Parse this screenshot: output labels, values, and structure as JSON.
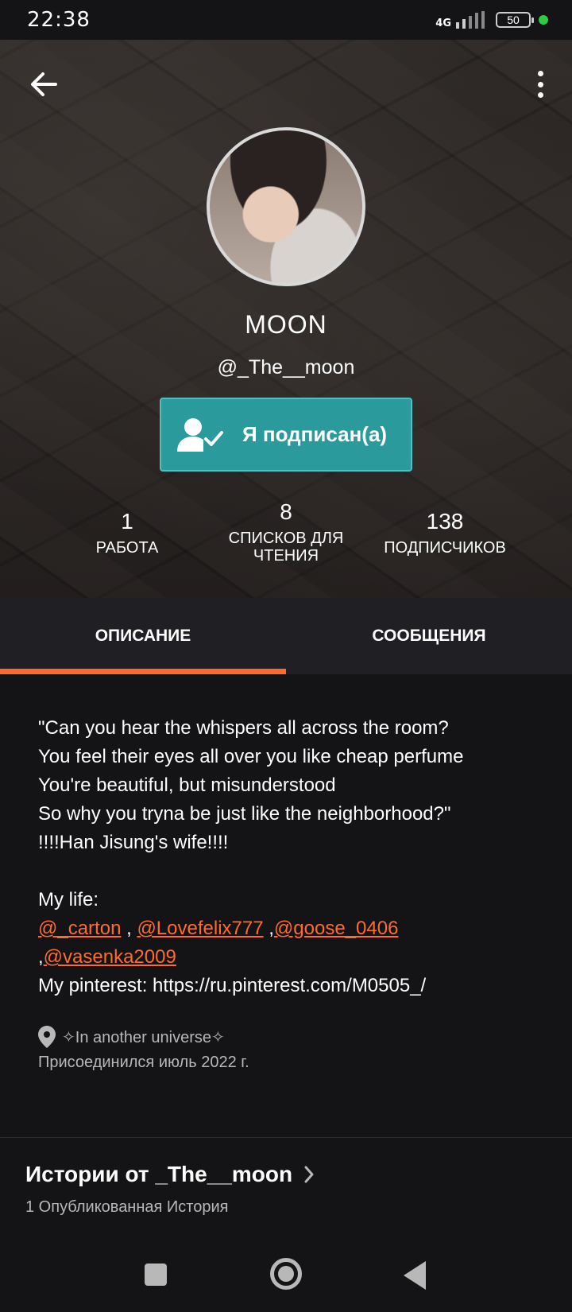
{
  "status_bar": {
    "time": "22:38",
    "network": "4G",
    "battery": "50",
    "signal_icon": "signal-bars-icon",
    "battery_icon": "battery-icon"
  },
  "header": {
    "back_icon": "arrow-left-icon",
    "more_icon": "more-vertical-icon"
  },
  "profile": {
    "name": "MOON",
    "handle": "@_The__moon",
    "follow_button": {
      "label": "Я подписан(а)",
      "icon": "user-check-icon",
      "color": "#2a9a9c"
    },
    "stats": [
      {
        "value": "1",
        "label": "РАБОТА"
      },
      {
        "value": "8",
        "label_line1": "СПИСКОВ ДЛЯ",
        "label_line2": "ЧТЕНИЯ"
      },
      {
        "value": "138",
        "label": "ПОДПИСЧИКОВ"
      }
    ]
  },
  "tabs": [
    {
      "label": "ОПИСАНИЕ",
      "active": true
    },
    {
      "label": "СООБЩЕНИЯ",
      "active": false
    }
  ],
  "accent_color": "#ff6b2b",
  "about": {
    "lines": [
      "\"Can you hear the whispers all across the room?",
      "You feel their eyes all over you like cheap perfume",
      "You're beautiful, but misunderstood",
      "So why you tryna be just like the neighborhood?\"",
      "!!!!Han Jisung's wife!!!!"
    ],
    "my_life_label": "My life:",
    "mentions": [
      "@_carton",
      "@Lovefelix777",
      "@goose_0406",
      "@vasenka2009"
    ],
    "pinterest": "My pinterest: https://ru.pinterest.com/M0505_/",
    "location": "✧In another universe✧",
    "location_icon": "map-pin-icon",
    "joined": "Присоединился июль 2022 г."
  },
  "stories": {
    "title": "Истории от _The__moon",
    "subtitle": "1 Опубликованная История",
    "chevron_icon": "chevron-right-icon"
  },
  "nav": {
    "recents_icon": "square-icon",
    "home_icon": "circle-icon",
    "back_icon": "triangle-back-icon"
  }
}
